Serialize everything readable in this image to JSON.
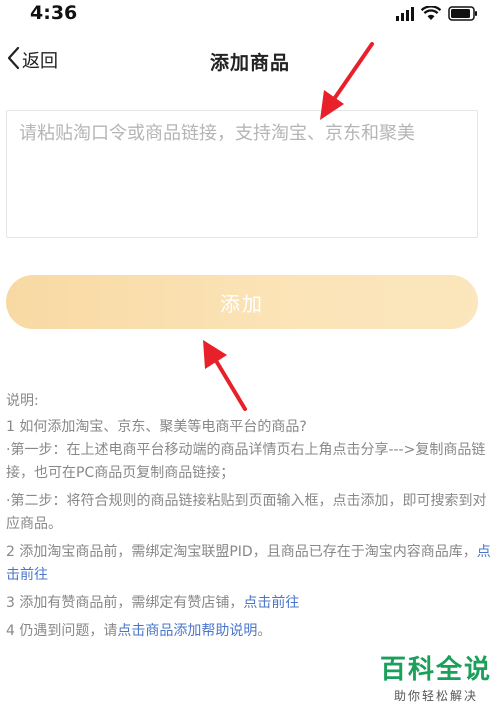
{
  "status": {
    "time": "4:36"
  },
  "nav": {
    "back_label": "返回",
    "title": "添加商品"
  },
  "input": {
    "placeholder": "请粘贴淘口令或商品链接，支持淘宝、京东和聚美",
    "value": ""
  },
  "button": {
    "label": "添加"
  },
  "instructions": {
    "heading": "说明:",
    "line1": "1 如何添加淘宝、京东、聚美等电商平台的商品?",
    "line2": "·第一步：在上述电商平台移动端的商品详情页右上角点击分享--->复制商品链接，也可在PC商品页复制商品链接；",
    "line3": "·第二步：将符合规则的商品链接粘贴到页面输入框，点击添加，即可搜索到对应商品。",
    "line4_text": "2 添加淘宝商品前，需绑定淘宝联盟PID，且商品已存在于淘宝内容商品库，",
    "line4_link": "点击前往",
    "line5_text": "3 添加有赞商品前，需绑定有赞店铺，",
    "line5_link": "点击前往",
    "line6_text": "4 仍遇到问题，请",
    "line6_link": "点击商品添加帮助说明",
    "line6_end": "。"
  },
  "watermark": {
    "title": "百科全说",
    "subtitle": "助你轻松解决"
  },
  "colors": {
    "button_start": "#f8d9a3",
    "button_end": "#fbe6bd",
    "link": "#4a77c9",
    "arrow": "#e8202a",
    "watermark": "#1aa05a"
  }
}
